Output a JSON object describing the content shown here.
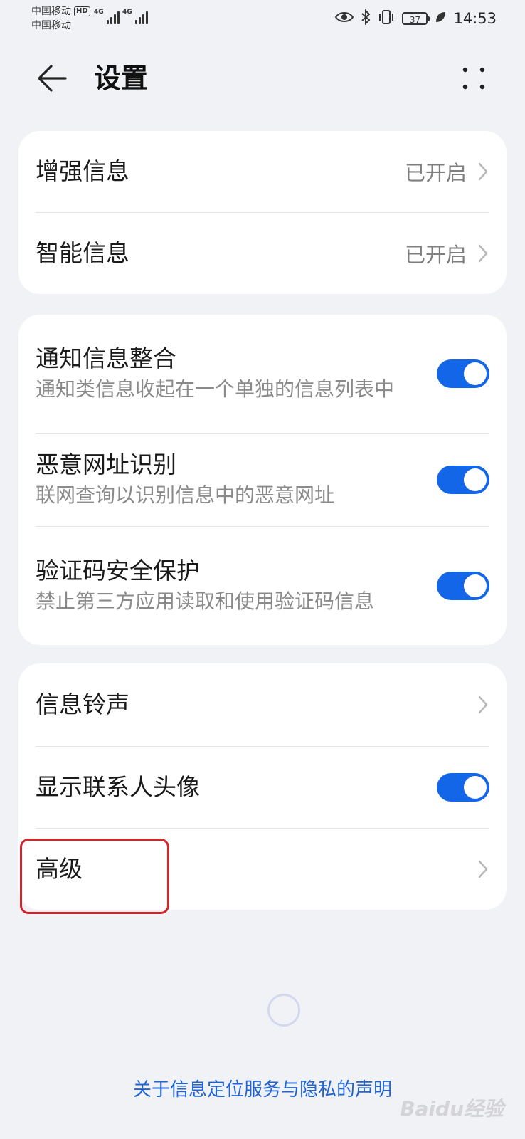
{
  "status_bar": {
    "carrier_1": "中国移动",
    "carrier_1_badge": "HD",
    "carrier_2": "中国移动",
    "network_1": "4G",
    "network_2": "4G",
    "battery_level": "37",
    "time": "14:53"
  },
  "header": {
    "title": "设置"
  },
  "card_1": {
    "items": [
      {
        "label": "增强信息",
        "value": "已开启"
      },
      {
        "label": "智能信息",
        "value": "已开启"
      }
    ]
  },
  "card_2": {
    "items": [
      {
        "label": "通知信息整合",
        "desc": "通知类信息收起在一个单独的信息列表中",
        "enabled": true
      },
      {
        "label": "恶意网址识别",
        "desc": "联网查询以识别信息中的恶意网址",
        "enabled": true
      },
      {
        "label": "验证码安全保护",
        "desc": "禁止第三方应用读取和使用验证码信息",
        "enabled": true
      }
    ]
  },
  "card_3": {
    "items": [
      {
        "label": "信息铃声"
      },
      {
        "label": "显示联系人头像",
        "enabled": true
      },
      {
        "label": "高级"
      }
    ]
  },
  "footer": {
    "link": "关于信息定位服务与隐私的声明"
  },
  "watermark": {
    "text": "Baidu经验"
  },
  "colors": {
    "accent": "#1366e7",
    "link": "#1f63d6",
    "highlight": "#d3262b",
    "background": "#f1f2f6"
  }
}
